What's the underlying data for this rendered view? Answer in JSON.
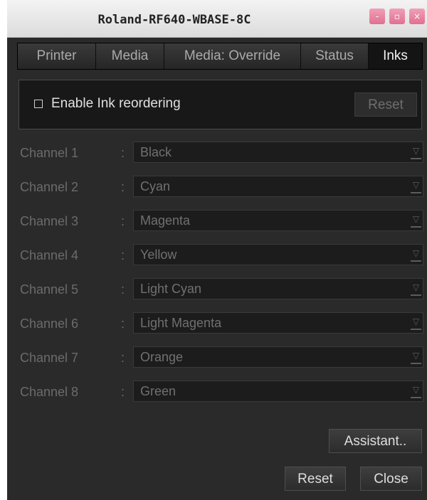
{
  "window": {
    "title": "Roland-RF640-WBASE-8C",
    "controls": {
      "minimize": "-",
      "maximize": "▫",
      "close": "×"
    }
  },
  "tabs": [
    {
      "label": "Printer",
      "active": false
    },
    {
      "label": "Media",
      "active": false
    },
    {
      "label": "Media: Override",
      "active": false
    },
    {
      "label": "Status",
      "active": false
    },
    {
      "label": "Inks",
      "active": true
    }
  ],
  "reorder": {
    "checkbox_label": "Enable Ink reordering",
    "checked": false,
    "reset_label": "Reset"
  },
  "channels": [
    {
      "label": "Channel 1",
      "value": "Black"
    },
    {
      "label": "Channel 2",
      "value": "Cyan"
    },
    {
      "label": "Channel 3",
      "value": "Magenta"
    },
    {
      "label": "Channel 4",
      "value": "Yellow"
    },
    {
      "label": "Channel 5",
      "value": "Light Cyan"
    },
    {
      "label": "Channel 6",
      "value": "Light Magenta"
    },
    {
      "label": "Channel 7",
      "value": "Orange"
    },
    {
      "label": "Channel 8",
      "value": "Green"
    }
  ],
  "colon": ":",
  "dropdown_glyph": "▽",
  "buttons": {
    "assistant": "Assistant..",
    "reset": "Reset",
    "close": "Close"
  },
  "colors": {
    "content_bg": "#2a2a2a",
    "title_button": "#e07090"
  }
}
